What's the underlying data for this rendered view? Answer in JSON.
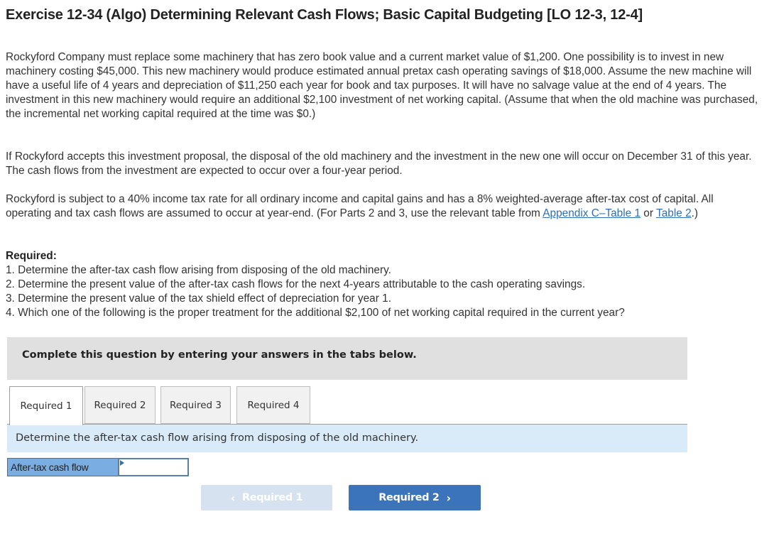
{
  "header": {
    "title": "Exercise 12-34 (Algo) Determining Relevant Cash Flows; Basic Capital Budgeting [LO 12-3, 12-4]"
  },
  "problem": {
    "paragraph1": "Rockyford Company must replace some machinery that has zero book value and a current market value of $1,200. One possibility is to invest in new machinery costing $45,000. This new machinery would produce estimated annual pretax cash operating savings of $18,000. Assume the new machine will have a useful life of 4 years and depreciation of $11,250 each year for book and tax purposes. It will have no salvage value at the end of 4 years. The investment in this new machinery would require an additional $2,100 investment of net working capital. (Assume that when the old machine was purchased, the incremental net working capital required at the time was $0.)",
    "paragraph2": "If Rockyford accepts this investment proposal, the disposal of the old machinery and the investment in the new one will occur on December 31 of this year. The cash flows from the investment are expected to occur over a four-year period.",
    "paragraph3_prefix": "Rockyford is subject to a 40% income tax rate for all ordinary income and capital gains and has a 8% weighted-average after-tax cost of capital. All operating and tax cash flows are assumed to occur at year-end. (For Parts 2 and 3, use the relevant table from ",
    "link_appendix": "Appendix C–Table 1",
    "paragraph3_mid": " or ",
    "link_table2": "Table 2",
    "paragraph3_suffix": ".)"
  },
  "required": {
    "heading": "Required:",
    "items": [
      "1. Determine the after-tax cash flow arising from disposing of the old machinery.",
      "2. Determine the present value of the after-tax cash flows for the next 4-years attributable to the cash operating savings.",
      "3. Determine the present value of the tax shield effect of depreciation for year 1.",
      "4. Which one of the following is the proper treatment for the additional $2,100 of net working capital required in the current year?"
    ]
  },
  "instructions": "Complete this question by entering your answers in the tabs below.",
  "tabs": [
    {
      "label": "Required 1",
      "active": true
    },
    {
      "label": "Required 2",
      "active": false
    },
    {
      "label": "Required 3",
      "active": false
    },
    {
      "label": "Required 4",
      "active": false
    }
  ],
  "tab_content": {
    "prompt": "Determine the after-tax cash flow arising from disposing of the old machinery.",
    "answer_label": "After-tax cash flow",
    "answer_value": ""
  },
  "navigation": {
    "prev_label": "Required 1",
    "prev_enabled": false,
    "next_label": "Required 2",
    "next_enabled": true
  },
  "colors": {
    "link": "#2f6fb5",
    "next_button": "#3c74bb",
    "prev_button_disabled": "#d6e2ef",
    "prompt_bar": "#d9ebf9",
    "instruction_box": "#e0e0e0",
    "answer_label_bg": "#7aaee3"
  }
}
